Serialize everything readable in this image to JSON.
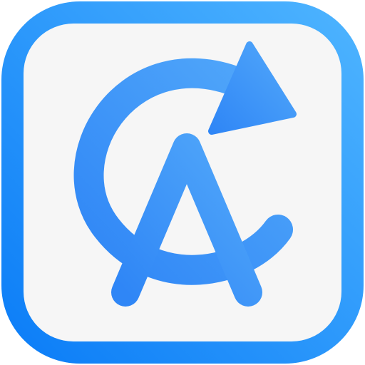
{
  "icon": {
    "name": "app-icon",
    "glyph": "refresh-letter-a",
    "colors": {
      "frame_gradient_start": "#0a7cf7",
      "frame_gradient_end": "#4fb5ff",
      "inner_background": "#f6f6f6",
      "glyph_gradient_start": "#2f86f6",
      "glyph_gradient_end": "#52a8fa"
    }
  }
}
